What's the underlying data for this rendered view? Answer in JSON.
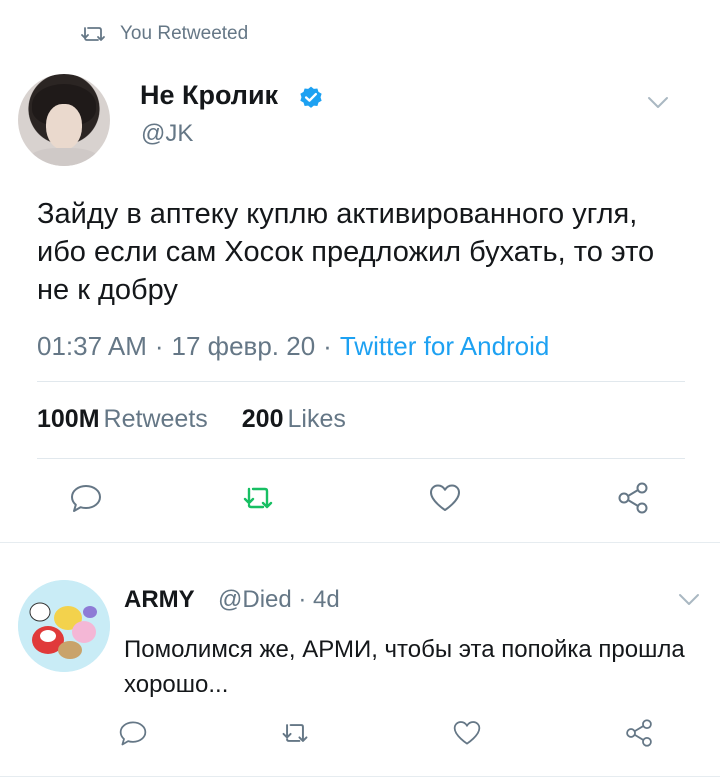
{
  "retweet_header": {
    "text": "You Retweeted"
  },
  "tweet": {
    "display_name": "Не Кролик",
    "handle": "@JK",
    "text": "Зайду в аптеку куплю активированного угля, ибо если сам Хосок предложил бухать, то это не к добру",
    "time": "01:37 AM",
    "date": "17 февр. 20",
    "separator": "·",
    "source": "Twitter for Android",
    "retweets_count": "100M",
    "retweets_label": "Retweets",
    "likes_count": "200",
    "likes_label": "Likes"
  },
  "reply": {
    "display_name": "ARMY",
    "handle_time": "@Died · 4d",
    "text": "Помолимся же, АРМИ, чтобы эта попойка прошла хорошо..."
  },
  "colors": {
    "accent": "#1da1f2",
    "retweet_active": "#17bf63",
    "muted": "#657786",
    "divider": "#e1e8ed"
  },
  "icons": {
    "retweet_header": "retweet-icon",
    "verified": "verified-badge-icon",
    "menu": "chevron-down-icon",
    "reply": "reply-icon",
    "retweet": "retweet-icon",
    "like": "heart-icon",
    "share": "share-icon"
  }
}
